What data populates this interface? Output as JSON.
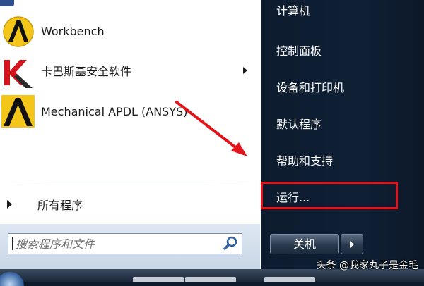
{
  "start_menu": {
    "programs": [
      {
        "label": "Workbench",
        "icon": "workbench-logo-icon"
      },
      {
        "label": "卡巴斯基安全软件",
        "icon": "kaspersky-logo-icon",
        "has_submenu": true
      },
      {
        "label": "Mechanical APDL (ANSYS)",
        "icon": "ansys-apdl-logo-icon"
      }
    ],
    "all_programs_label": "所有程序",
    "search_placeholder": "搜索程序和文件"
  },
  "right_panel": {
    "items": [
      "计算机",
      "控制面板",
      "设备和打印机",
      "默认程序",
      "帮助和支持",
      "运行..."
    ],
    "shutdown_label": "关机"
  },
  "annotation": {
    "color": "#e0141a",
    "target": "运行..."
  },
  "watermark": "头条 @我家丸子是金毛"
}
